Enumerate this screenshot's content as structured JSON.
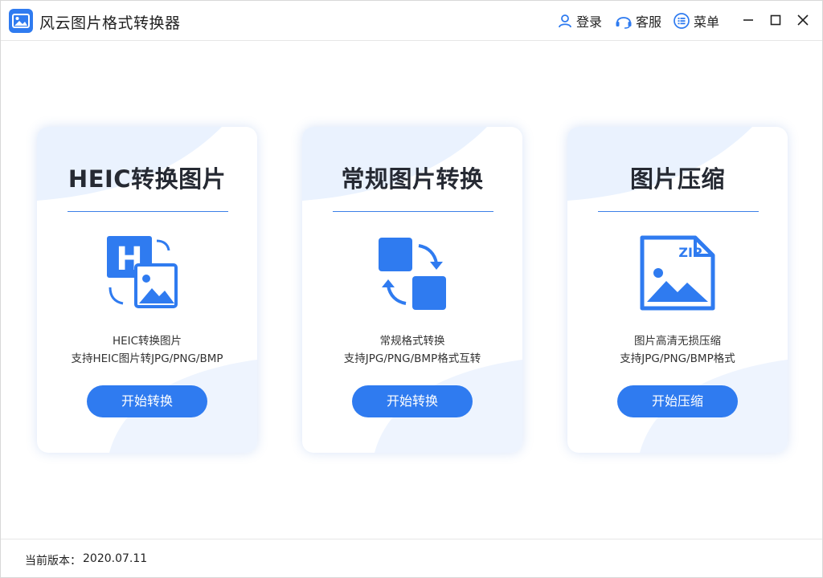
{
  "app": {
    "title": "风云图片格式转换器",
    "accent_color": "#2f7bf0",
    "logo_icon": "image-landscape-icon"
  },
  "header": {
    "login_label": "登录",
    "login_icon": "user-icon",
    "service_label": "客服",
    "service_icon": "headset-icon",
    "menu_label": "菜单",
    "menu_icon": "list-menu-icon",
    "window_controls": [
      "minimize-icon",
      "maximize-icon",
      "close-icon"
    ]
  },
  "cards": [
    {
      "title": "HEIC转换图片",
      "icon": "heic-to-image-icon",
      "desc_line1": "HEIC转换图片",
      "desc_line2": "支持HEIC图片转JPG/PNG/BMP",
      "button_label": "开始转换"
    },
    {
      "title": "常规图片转换",
      "icon": "format-convert-icon",
      "desc_line1": "常规格式转换",
      "desc_line2": "支持JPG/PNG/BMP格式互转",
      "button_label": "开始转换"
    },
    {
      "title": "图片压缩",
      "icon": "zip-image-icon",
      "icon_text": "ZIP",
      "desc_line1": "图片高清无损压缩",
      "desc_line2": "支持JPG/PNG/BMP格式",
      "button_label": "开始压缩"
    }
  ],
  "footer": {
    "version_label": "当前版本：",
    "version_value": "2020.07.11"
  }
}
